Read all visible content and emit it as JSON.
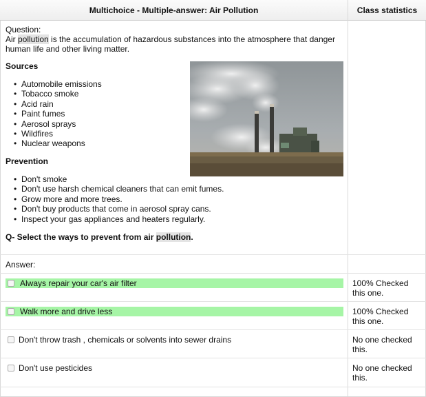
{
  "header": {
    "question_title": "Multichoice - Multiple-answer: Air Pollution",
    "stats_title": "Class statistics"
  },
  "question": {
    "label": "Question:",
    "intro_pre": "Air ",
    "intro_highlight": "pollution",
    "intro_post": " is the accumulation of hazardous substances into the atmosphere that danger human life and other living matter.",
    "sources_heading": "Sources",
    "sources": [
      "Automobile emissions",
      "Tobacco smoke",
      "Acid rain",
      "Paint fumes",
      "Aerosol sprays",
      "Wildfires",
      "Nuclear weapons"
    ],
    "prevention_heading": "Prevention",
    "prevention": [
      "Don't smoke",
      "Don't use harsh chemical cleaners that can emit fumes.",
      "Grow more and more trees.",
      "Don't buy products that come in aerosol spray cans.",
      "Inspect your gas appliances and heaters regularly."
    ],
    "prompt_pre": "Q- Select the ways to prevent from air ",
    "prompt_highlight": "pollution",
    "prompt_post": ".",
    "image_icon": "factory-smokestack-photo"
  },
  "answer": {
    "label": "Answer:",
    "options": [
      {
        "text": "Always repair your car's air filter",
        "correct": true,
        "stat": "100% Checked this one."
      },
      {
        "text": "Walk more and drive less",
        "correct": true,
        "stat": "100% Checked this one."
      },
      {
        "text": "Don't throw trash , chemicals or solvents into sewer drains",
        "correct": false,
        "stat": "No one checked this."
      },
      {
        "text": "Don't use pesticides",
        "correct": false,
        "stat": "No one checked this."
      }
    ]
  },
  "colors": {
    "correct_highlight": "#a6f5a6",
    "term_highlight": "#e4e4e4"
  }
}
